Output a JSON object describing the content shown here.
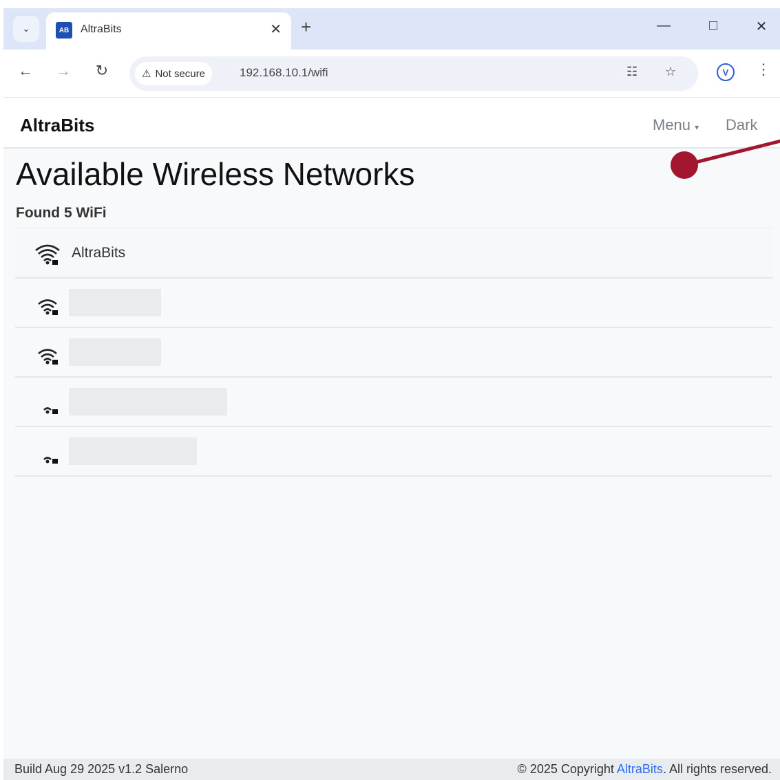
{
  "browser": {
    "tab_title": "AltraBits",
    "tab_favicon_text": "AB",
    "tab_dropdown_icon": "chevron-down-icon",
    "security_label": "Not secure",
    "url": "192.168.10.1/wifi"
  },
  "navbar": {
    "brand": "AltraBits",
    "menu_label": "Menu",
    "dark_label": "Dark"
  },
  "main": {
    "title": "Available Wireless Networks",
    "count_text": "Found 5 WiFi",
    "networks": [
      {
        "ssid": "AltraBits",
        "signal": 4,
        "redacted": false
      },
      {
        "ssid": "",
        "signal": 3,
        "redacted": true
      },
      {
        "ssid": "",
        "signal": 3,
        "redacted": true
      },
      {
        "ssid": "",
        "signal": 1,
        "redacted": true
      },
      {
        "ssid": "",
        "signal": 1,
        "redacted": true
      }
    ]
  },
  "footer": {
    "build": "Build Aug 29 2025 v1.2 Salerno",
    "copyright_prefix": "© 2025 Copyright ",
    "copyright_link": "AltraBits",
    "copyright_suffix": ". All rights reserved."
  },
  "colors": {
    "annotation": "#a3162f",
    "link": "#2b6cf0",
    "page_bg": "#f8f9fa"
  }
}
